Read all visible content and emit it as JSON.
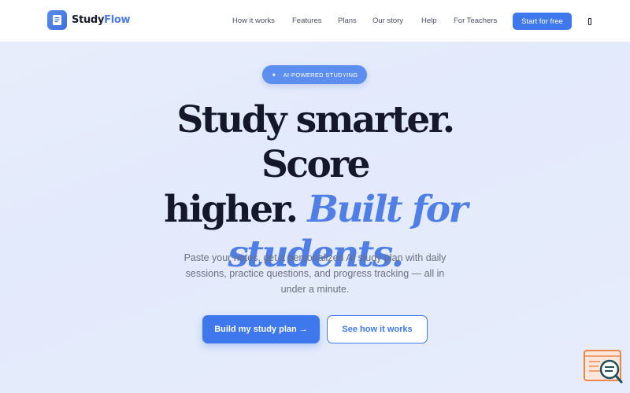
{
  "brand": {
    "name_part1": "Study",
    "name_part2": "Flow"
  },
  "nav": {
    "links": [
      "How it works",
      "Features",
      "Plans",
      "Our story",
      "Help",
      "For Teachers"
    ],
    "cta_label": "Start for free"
  },
  "hero": {
    "badge_icon": "sparkle-icon",
    "badge": "AI-POWERED STUDYING",
    "title_line1": "Study smarter. Score",
    "title_line2_plain": "higher.",
    "title_line2_accent": "Built for",
    "title_line3_accent": "students.",
    "subtitle": "Paste your notes, get a personalized AI study plan with daily sessions, practice questions, and progress tracking — all in under a minute.",
    "primary_button": "Build my study plan →",
    "secondary_button": "See how it works"
  },
  "colors": {
    "accent": "#3f78ec",
    "accent_text": "#4f7fe6",
    "heading": "#15182a"
  }
}
